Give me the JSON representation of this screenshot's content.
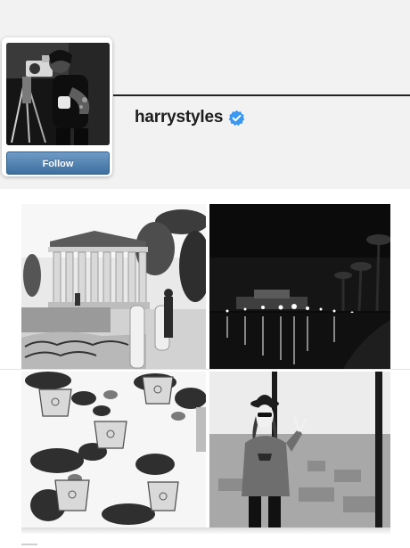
{
  "profile": {
    "username": "harrystyles",
    "verified": true,
    "follow_label": "Follow",
    "accent_color": "#3897f0",
    "follow_button_color": "#4f7fae"
  },
  "photos": [
    {
      "subject": "round temple ruins with pine trees"
    },
    {
      "subject": "city waterfront lights at night"
    },
    {
      "subject": "potted plants hanging on white wall"
    },
    {
      "subject": "man in hat and hoodie making peace sign by window"
    }
  ]
}
